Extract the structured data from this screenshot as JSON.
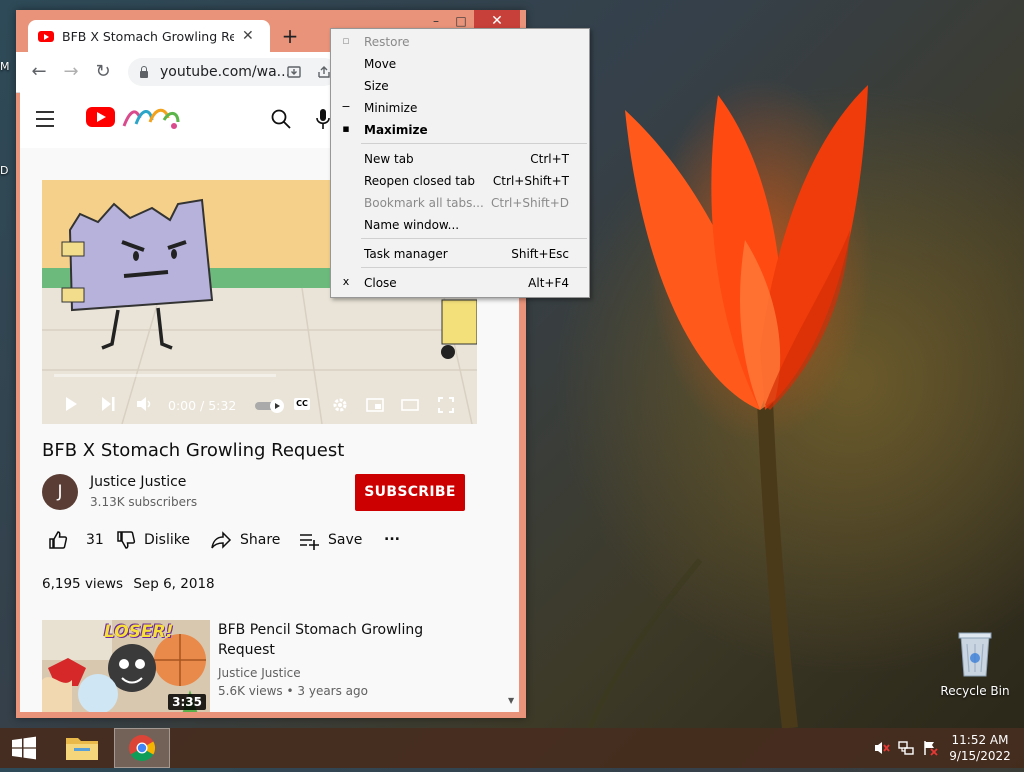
{
  "desktop": {
    "left_clip_top": "M",
    "left_clip_bottom": "D",
    "recycle_bin_label": "Recycle Bin"
  },
  "browser": {
    "tab_title": "BFB X Stomach Growling Request",
    "tab_close": "✕",
    "new_tab": "+",
    "url": "youtube.com/wa...",
    "window_buttons": {
      "minimize": "–",
      "maximize": "□",
      "close": "✕"
    },
    "nav": {
      "back": "←",
      "forward": "→",
      "reload": "↻"
    }
  },
  "youtube": {
    "video": {
      "time": "0:00 / 5:32",
      "cc_label": "CC",
      "progress": 0.0
    },
    "title": "BFB X Stomach Growling Request",
    "channel": {
      "avatar_letter": "J",
      "name": "Justice Justice",
      "subscribers": "3.13K subscribers"
    },
    "subscribe_label": "SUBSCRIBE",
    "actions": {
      "like_count": "31",
      "dislike": "Dislike",
      "share": "Share",
      "save": "Save",
      "more": "..."
    },
    "meta": {
      "views": "6,195 views",
      "date": "Sep 6, 2018"
    },
    "recommended": {
      "title": "BFB Pencil Stomach Growling Request",
      "channel": "Justice Justice",
      "views": "5.6K views",
      "age": "3 years ago",
      "duration": "3:35",
      "thumb_text": "LOSER!"
    }
  },
  "context_menu": {
    "items": [
      {
        "label": "Restore",
        "shortcut": "",
        "disabled": true,
        "bold": false,
        "glyph": "restore"
      },
      {
        "label": "Move",
        "shortcut": "",
        "disabled": false,
        "bold": false,
        "glyph": ""
      },
      {
        "label": "Size",
        "shortcut": "",
        "disabled": false,
        "bold": false,
        "glyph": ""
      },
      {
        "label": "Minimize",
        "shortcut": "",
        "disabled": false,
        "bold": false,
        "glyph": "minimize"
      },
      {
        "label": "Maximize",
        "shortcut": "",
        "disabled": false,
        "bold": true,
        "glyph": "maximize"
      },
      {
        "label": "New tab",
        "shortcut": "Ctrl+T",
        "disabled": false,
        "bold": false,
        "glyph": ""
      },
      {
        "label": "Reopen closed tab",
        "shortcut": "Ctrl+Shift+T",
        "disabled": false,
        "bold": false,
        "glyph": ""
      },
      {
        "label": "Bookmark all tabs...",
        "shortcut": "Ctrl+Shift+D",
        "disabled": true,
        "bold": false,
        "glyph": ""
      },
      {
        "label": "Name window...",
        "shortcut": "",
        "disabled": false,
        "bold": false,
        "glyph": ""
      },
      {
        "label": "Task manager",
        "shortcut": "Shift+Esc",
        "disabled": false,
        "bold": false,
        "glyph": ""
      },
      {
        "label": "Close",
        "shortcut": "Alt+F4",
        "disabled": false,
        "bold": false,
        "glyph": "close"
      }
    ],
    "glyphs": {
      "restore": "▫",
      "minimize": "−",
      "maximize": "▪",
      "close": "x"
    }
  },
  "taskbar": {
    "clock_time": "11:52 AM",
    "clock_date": "9/15/2022"
  },
  "colors": {
    "window_frame": "#e8937a",
    "close_button": "#c8403a",
    "subscribe": "#cc0000",
    "youtube_red": "#ff0000"
  }
}
